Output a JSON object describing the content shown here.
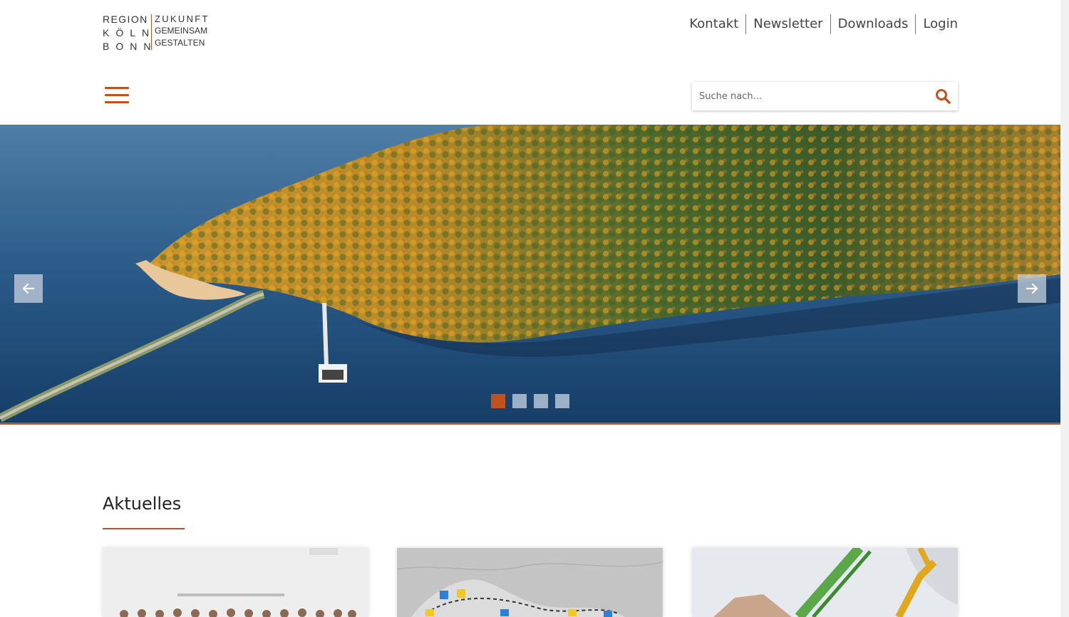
{
  "logo": {
    "left_lines": [
      "REGION",
      "KÖLN",
      "BONN"
    ],
    "right_lines": [
      "ZUKUNFT",
      "GEMEINSAM",
      "GESTALTEN"
    ]
  },
  "topnav": {
    "items": [
      "Kontakt",
      "Newsletter",
      "Downloads",
      "Login"
    ]
  },
  "menu": {
    "icon": "hamburger-menu-icon"
  },
  "search": {
    "placeholder": "Suche nach...",
    "value": "",
    "icon": "search-icon"
  },
  "slider": {
    "prev_icon": "arrow-left-icon",
    "next_icon": "arrow-right-icon",
    "slide_count": 4,
    "active_index": 0
  },
  "section": {
    "title": "Aktuelles"
  },
  "colors": {
    "accent": "#c0521f",
    "text": "#333333",
    "lake": "#1d4771"
  }
}
